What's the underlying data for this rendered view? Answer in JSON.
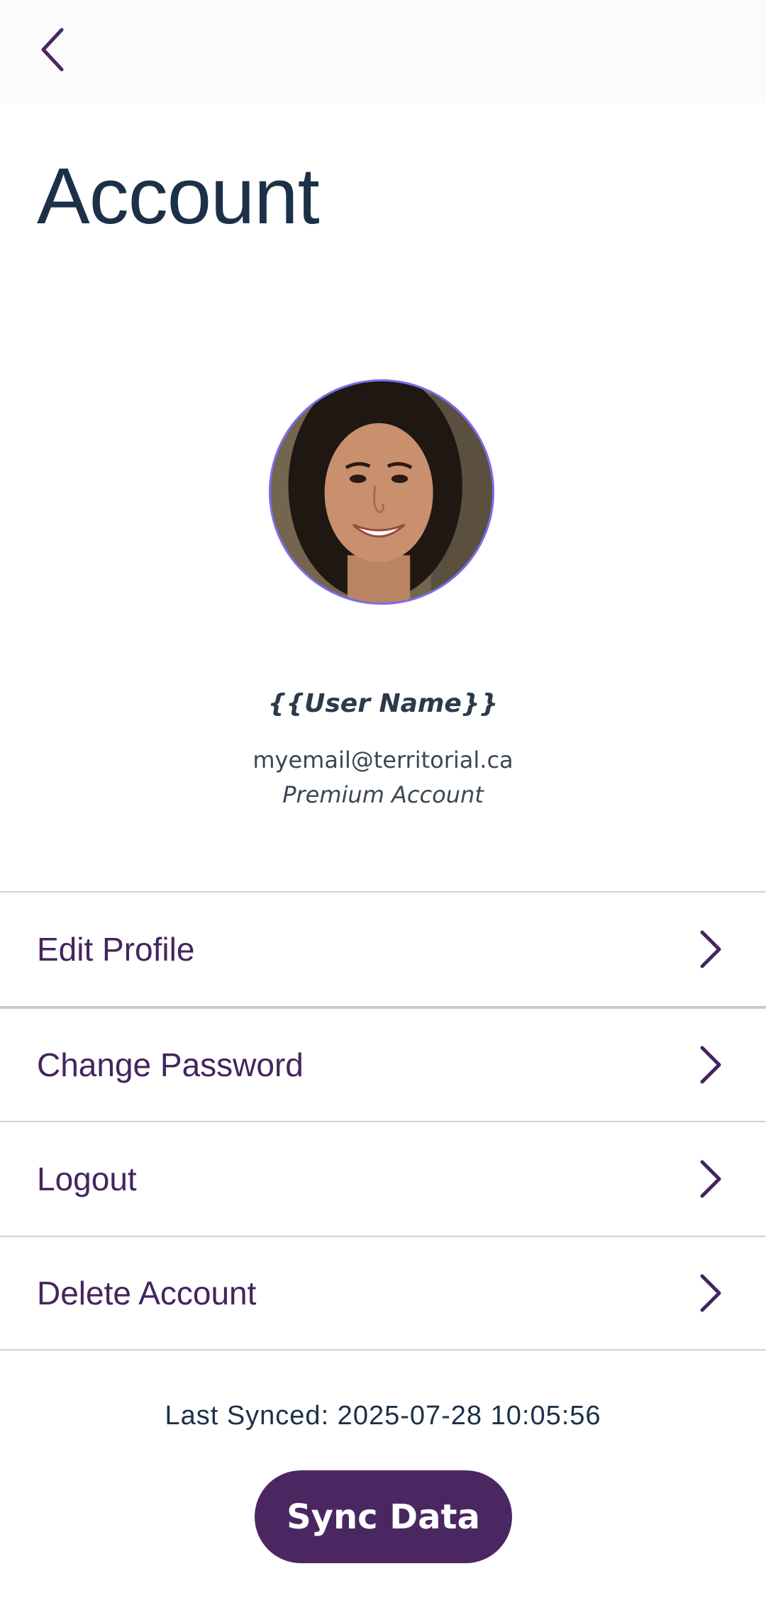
{
  "header": {
    "back_icon": "chevron-left-icon"
  },
  "page": {
    "title": "Account"
  },
  "profile": {
    "avatar": "user-avatar-photo",
    "name": "{{User Name}}",
    "email": "myemail@territorial.ca",
    "plan": "Premium Account"
  },
  "menu": {
    "items": [
      {
        "label": "Edit Profile",
        "icon": "chevron-right-icon"
      },
      {
        "label": "Change Password",
        "icon": "chevron-right-icon"
      },
      {
        "label": "Logout",
        "icon": "chevron-right-icon"
      },
      {
        "label": "Delete Account",
        "icon": "chevron-right-icon"
      }
    ]
  },
  "sync": {
    "last_synced": "Last Synced: 2025-07-28 10:05:56",
    "button_label": "Sync Data"
  },
  "colors": {
    "accent": "#4b2762",
    "menu_text": "#45245e",
    "title_text": "#1c3048",
    "avatar_ring": "#7b6cf0"
  }
}
